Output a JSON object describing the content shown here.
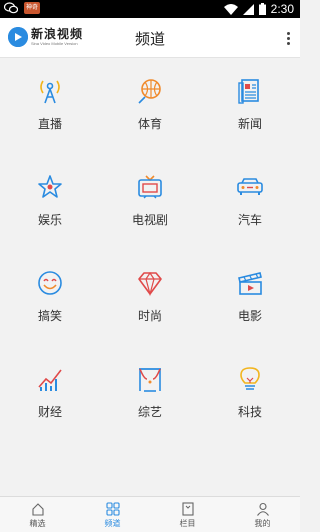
{
  "status_bar": {
    "time": "2:30",
    "app_badge": "神奇"
  },
  "header": {
    "logo_text": "新浪视频",
    "logo_subtitle": "Sina Video Mobile Version",
    "title": "频道"
  },
  "channels": [
    {
      "label": "直播",
      "icon": "broadcast-tower-icon"
    },
    {
      "label": "体育",
      "icon": "basketball-icon"
    },
    {
      "label": "新闻",
      "icon": "newspaper-icon"
    },
    {
      "label": "娱乐",
      "icon": "star-icon"
    },
    {
      "label": "电视剧",
      "icon": "tv-icon"
    },
    {
      "label": "汽车",
      "icon": "car-icon"
    },
    {
      "label": "搞笑",
      "icon": "smiley-icon"
    },
    {
      "label": "时尚",
      "icon": "diamond-icon"
    },
    {
      "label": "电影",
      "icon": "clapperboard-icon"
    },
    {
      "label": "财经",
      "icon": "trend-chart-icon"
    },
    {
      "label": "综艺",
      "icon": "stage-curtain-icon"
    },
    {
      "label": "科技",
      "icon": "lightbulb-icon"
    }
  ],
  "colors": {
    "blue": "#2a8be0",
    "orange": "#f08a2c",
    "red": "#e04a4a",
    "yellow": "#f2b51e"
  },
  "tabs": [
    {
      "label": "精选",
      "icon": "home-icon",
      "active": false
    },
    {
      "label": "频道",
      "icon": "grid-icon",
      "active": true
    },
    {
      "label": "栏目",
      "icon": "bookmark-icon",
      "active": false
    },
    {
      "label": "我的",
      "icon": "person-icon",
      "active": false
    }
  ]
}
